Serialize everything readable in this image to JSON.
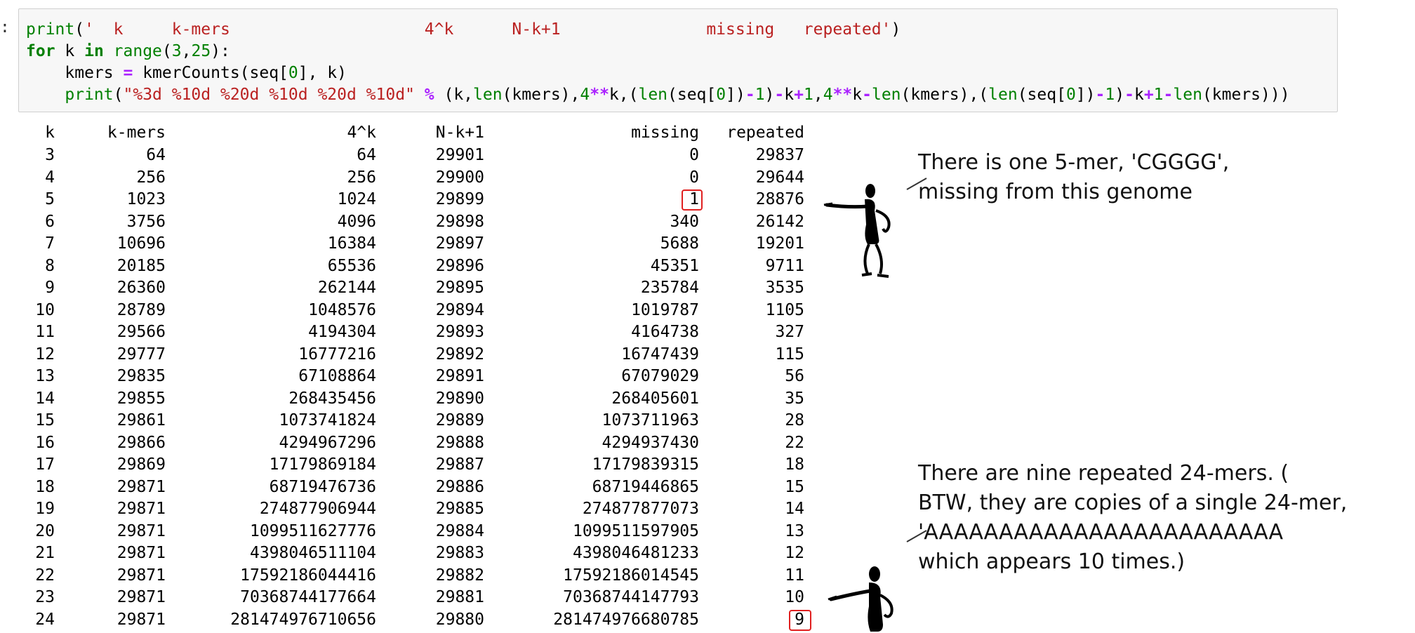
{
  "prompt": ":",
  "code": {
    "line1": [
      {
        "t": "print",
        "c": "bi"
      },
      {
        "t": "(",
        "c": ""
      },
      {
        "t": "'  k     k-mers                    4^k      N-k+1               missing   repeated'",
        "c": "str"
      },
      {
        "t": ")",
        "c": ""
      }
    ],
    "line2": [
      {
        "t": "for",
        "c": "kw"
      },
      {
        "t": " k ",
        "c": ""
      },
      {
        "t": "in",
        "c": "kw"
      },
      {
        "t": " ",
        "c": ""
      },
      {
        "t": "range",
        "c": "bi"
      },
      {
        "t": "(",
        "c": ""
      },
      {
        "t": "3",
        "c": "num"
      },
      {
        "t": ",",
        "c": ""
      },
      {
        "t": "25",
        "c": "num"
      },
      {
        "t": "):",
        "c": ""
      }
    ],
    "line3": [
      {
        "t": "    kmers ",
        "c": ""
      },
      {
        "t": "=",
        "c": "op"
      },
      {
        "t": " kmerCounts(seq[",
        "c": ""
      },
      {
        "t": "0",
        "c": "num"
      },
      {
        "t": "], k)",
        "c": ""
      }
    ],
    "line4": [
      {
        "t": "    ",
        "c": ""
      },
      {
        "t": "print",
        "c": "bi"
      },
      {
        "t": "(",
        "c": ""
      },
      {
        "t": "\"%3d %10d %20d %10d %20d %10d\"",
        "c": "str"
      },
      {
        "t": " ",
        "c": ""
      },
      {
        "t": "%",
        "c": "op"
      },
      {
        "t": " (k,",
        "c": ""
      },
      {
        "t": "len",
        "c": "bi"
      },
      {
        "t": "(kmers),",
        "c": ""
      },
      {
        "t": "4",
        "c": "num"
      },
      {
        "t": "**",
        "c": "op"
      },
      {
        "t": "k,(",
        "c": ""
      },
      {
        "t": "len",
        "c": "bi"
      },
      {
        "t": "(seq[",
        "c": ""
      },
      {
        "t": "0",
        "c": "num"
      },
      {
        "t": "])",
        "c": ""
      },
      {
        "t": "-",
        "c": "op"
      },
      {
        "t": "1",
        "c": "num"
      },
      {
        "t": ")",
        "c": ""
      },
      {
        "t": "-",
        "c": "op"
      },
      {
        "t": "k",
        "c": ""
      },
      {
        "t": "+",
        "c": "op"
      },
      {
        "t": "1",
        "c": "num"
      },
      {
        "t": ",",
        "c": ""
      },
      {
        "t": "4",
        "c": "num"
      },
      {
        "t": "**",
        "c": "op"
      },
      {
        "t": "k",
        "c": ""
      },
      {
        "t": "-",
        "c": "op"
      },
      {
        "t": "len",
        "c": "bi"
      },
      {
        "t": "(kmers),(",
        "c": ""
      },
      {
        "t": "len",
        "c": "bi"
      },
      {
        "t": "(seq[",
        "c": ""
      },
      {
        "t": "0",
        "c": "num"
      },
      {
        "t": "])",
        "c": ""
      },
      {
        "t": "-",
        "c": "op"
      },
      {
        "t": "1",
        "c": "num"
      },
      {
        "t": ")",
        "c": ""
      },
      {
        "t": "-",
        "c": "op"
      },
      {
        "t": "k",
        "c": ""
      },
      {
        "t": "+",
        "c": "op"
      },
      {
        "t": "1",
        "c": "num"
      },
      {
        "t": "-",
        "c": "op"
      },
      {
        "t": "len",
        "c": "bi"
      },
      {
        "t": "(kmers)))",
        "c": ""
      }
    ]
  },
  "table": {
    "headers": {
      "k": "k",
      "kmers": "k-mers",
      "four_k": "4^k",
      "nk1": "N-k+1",
      "missing": "missing",
      "repeated": "repeated"
    },
    "rows": [
      [
        "3",
        "64",
        "64",
        "29901",
        "0",
        "29837"
      ],
      [
        "4",
        "256",
        "256",
        "29900",
        "0",
        "29644"
      ],
      [
        "5",
        "1023",
        "1024",
        "29899",
        "1",
        "28876"
      ],
      [
        "6",
        "3756",
        "4096",
        "29898",
        "340",
        "26142"
      ],
      [
        "7",
        "10696",
        "16384",
        "29897",
        "5688",
        "19201"
      ],
      [
        "8",
        "20185",
        "65536",
        "29896",
        "45351",
        "9711"
      ],
      [
        "9",
        "26360",
        "262144",
        "29895",
        "235784",
        "3535"
      ],
      [
        "10",
        "28789",
        "1048576",
        "29894",
        "1019787",
        "1105"
      ],
      [
        "11",
        "29566",
        "4194304",
        "29893",
        "4164738",
        "327"
      ],
      [
        "12",
        "29777",
        "16777216",
        "29892",
        "16747439",
        "115"
      ],
      [
        "13",
        "29835",
        "67108864",
        "29891",
        "67079029",
        "56"
      ],
      [
        "14",
        "29855",
        "268435456",
        "29890",
        "268405601",
        "35"
      ],
      [
        "15",
        "29861",
        "1073741824",
        "29889",
        "1073711963",
        "28"
      ],
      [
        "16",
        "29866",
        "4294967296",
        "29888",
        "4294937430",
        "22"
      ],
      [
        "17",
        "29869",
        "17179869184",
        "29887",
        "17179839315",
        "18"
      ],
      [
        "18",
        "29871",
        "68719476736",
        "29886",
        "68719446865",
        "15"
      ],
      [
        "19",
        "29871",
        "274877906944",
        "29885",
        "274877877073",
        "14"
      ],
      [
        "20",
        "29871",
        "1099511627776",
        "29884",
        "1099511597905",
        "13"
      ],
      [
        "21",
        "29871",
        "4398046511104",
        "29883",
        "4398046481233",
        "12"
      ],
      [
        "22",
        "29871",
        "17592186044416",
        "29882",
        "17592186014545",
        "11"
      ],
      [
        "23",
        "29871",
        "70368744177664",
        "29881",
        "70368744147793",
        "10"
      ],
      [
        "24",
        "29871",
        "281474976710656",
        "29880",
        "281474976680785",
        "9"
      ]
    ]
  },
  "highlight_color": "#e02020",
  "annotations": {
    "note1": "There is one 5-mer, 'CGGGG',\nmissing from this genome",
    "note2": "There are nine repeated 24-mers. (\nBTW, they are copies of a single 24-mer,\n'AAAAAAAAAAAAAAAAAAAAAAAA\nwhich appears 10 times.)"
  }
}
